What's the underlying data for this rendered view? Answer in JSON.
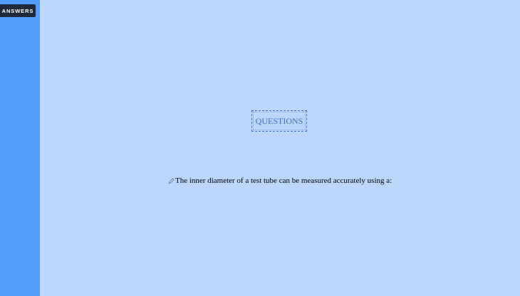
{
  "sidebar": {
    "answers_label": "ANSWERS"
  },
  "main": {
    "section_title": "QUESTIONS",
    "question_text": "The inner diameter of a test tube can be measured accurately using a:",
    "question_icon": "pencil-icon"
  },
  "colors": {
    "background": "#bad6fb",
    "sidebar": "#549cfb",
    "button": "#1f2a3a",
    "accent": "#3d6fc2"
  }
}
